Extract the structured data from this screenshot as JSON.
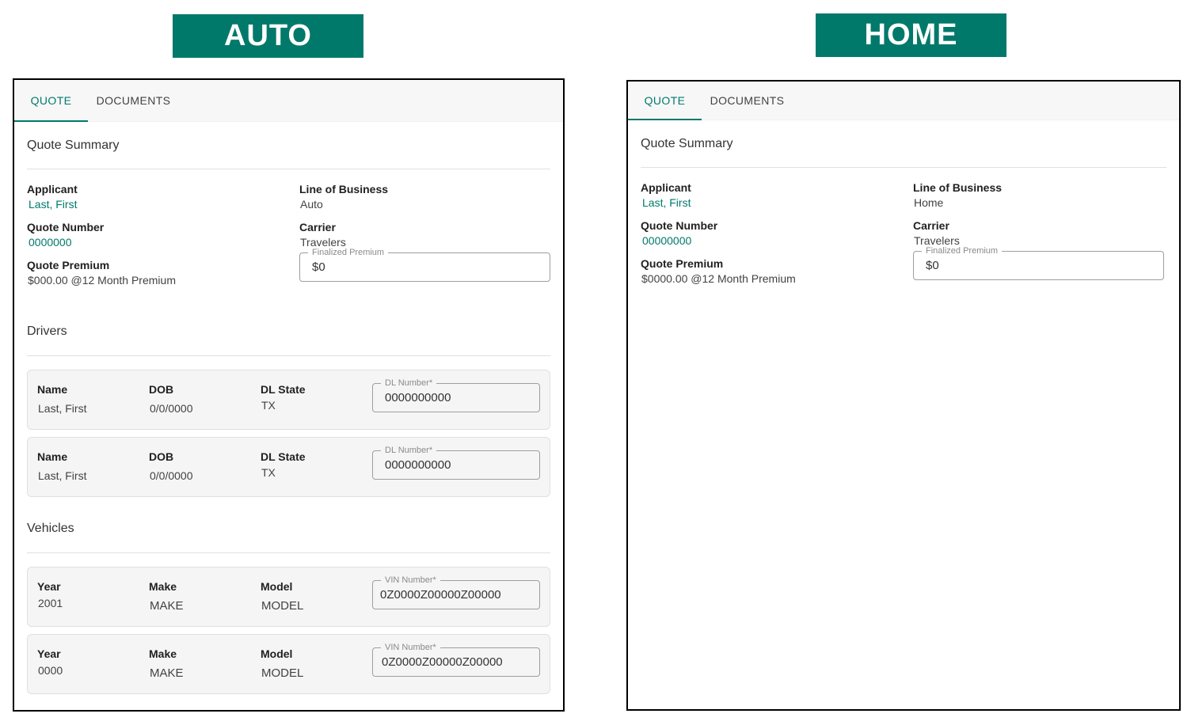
{
  "auto": {
    "banner": "AUTO",
    "tabs": {
      "quote": "QUOTE",
      "documents": "DOCUMENTS"
    },
    "summary_title": "Quote Summary",
    "applicant_label": "Applicant",
    "applicant_value": "Last, First",
    "quote_number_label": "Quote Number",
    "quote_number_value": "0000000",
    "quote_premium_label": "Quote Premium",
    "quote_premium_value": "$000.00 @12 Month Premium",
    "lob_label": "Line of Business",
    "lob_value": "Auto",
    "carrier_label": "Carrier",
    "carrier_value": "Travelers",
    "finalized_label": "Finalized Premium",
    "finalized_value": "$0",
    "drivers_title": "Drivers",
    "drivers": [
      {
        "name_label": "Name",
        "name": "Last, First",
        "dob_label": "DOB",
        "dob": "0/0/0000",
        "state_label": "DL State",
        "state": "TX",
        "dl_label": "DL Number*",
        "dl": "0000000000"
      },
      {
        "name_label": "Name",
        "name": "Last, First",
        "dob_label": "DOB",
        "dob": "0/0/0000",
        "state_label": "DL State",
        "state": "TX",
        "dl_label": "DL Number*",
        "dl": "0000000000"
      }
    ],
    "vehicles_title": "Vehicles",
    "vehicles": [
      {
        "year_label": "Year",
        "year": "2001",
        "make_label": "Make",
        "make": "MAKE",
        "model_label": "Model",
        "model": "MODEL",
        "vin_label": "VIN Number*",
        "vin": "0Z0000Z00000Z00000"
      },
      {
        "year_label": "Year",
        "year": "0000",
        "make_label": "Make",
        "make": "MAKE",
        "model_label": "Model",
        "model": "MODEL",
        "vin_label": "VIN Number*",
        "vin": "0Z0000Z00000Z00000"
      }
    ]
  },
  "home": {
    "banner": "HOME",
    "tabs": {
      "quote": "QUOTE",
      "documents": "DOCUMENTS"
    },
    "summary_title": "Quote Summary",
    "applicant_label": "Applicant",
    "applicant_value": "Last, First",
    "quote_number_label": "Quote Number",
    "quote_number_value": "00000000",
    "quote_premium_label": "Quote Premium",
    "quote_premium_value": "$0000.00 @12 Month Premium",
    "lob_label": "Line of Business",
    "lob_value": "Home",
    "carrier_label": "Carrier",
    "carrier_value": "Travelers",
    "finalized_label": "Finalized Premium",
    "finalized_value": "$0"
  },
  "colors": {
    "accent": "#00796b",
    "card_bg": "#f5f5f5",
    "border": "#000000"
  }
}
